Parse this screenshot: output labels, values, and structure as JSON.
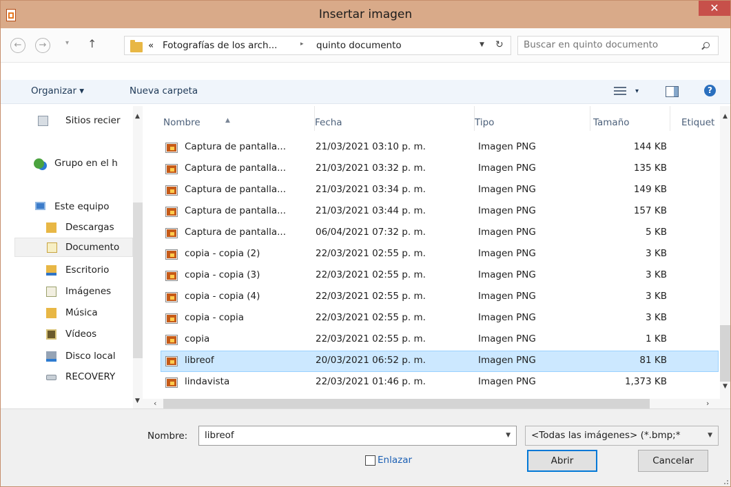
{
  "window": {
    "title": "Insertar imagen",
    "close_glyph": "✕"
  },
  "address": {
    "prefix": "«",
    "path": [
      "Fotografías de los arch...",
      "quinto documento"
    ],
    "separator": "▸"
  },
  "search": {
    "placeholder": "Buscar en quinto documento"
  },
  "toolbar": {
    "organize": "Organizar ▾",
    "new_folder": "Nueva carpeta",
    "view_dropdown": "▾"
  },
  "nav": {
    "items": [
      {
        "label": "Sitios recier",
        "icon": "recent-places-icon"
      },
      {
        "label": "Grupo en el h",
        "icon": "homegroup-icon"
      },
      {
        "label": "Este equipo",
        "icon": "computer-icon"
      },
      {
        "label": "Descargas",
        "icon": "downloads-folder-icon"
      },
      {
        "label": "Documento",
        "icon": "documents-folder-icon",
        "selected": true
      },
      {
        "label": "Escritorio",
        "icon": "desktop-folder-icon"
      },
      {
        "label": "Imágenes",
        "icon": "pictures-folder-icon"
      },
      {
        "label": "Música",
        "icon": "music-folder-icon"
      },
      {
        "label": "Vídeos",
        "icon": "videos-folder-icon"
      },
      {
        "label": "Disco local",
        "icon": "local-disk-icon"
      },
      {
        "label": "RECOVERY",
        "icon": "drive-icon"
      }
    ]
  },
  "columns": {
    "name": "Nombre",
    "date": "Fecha",
    "type": "Tipo",
    "size": "Tamaño",
    "tags": "Etiquet"
  },
  "files": [
    {
      "name": "Captura de pantalla...",
      "date": "21/03/2021 03:10 p. m.",
      "type": "Imagen PNG",
      "size": "144 KB"
    },
    {
      "name": "Captura de pantalla...",
      "date": "21/03/2021 03:32 p. m.",
      "type": "Imagen PNG",
      "size": "135 KB"
    },
    {
      "name": "Captura de pantalla...",
      "date": "21/03/2021 03:34 p. m.",
      "type": "Imagen PNG",
      "size": "149 KB"
    },
    {
      "name": "Captura de pantalla...",
      "date": "21/03/2021 03:44 p. m.",
      "type": "Imagen PNG",
      "size": "157 KB"
    },
    {
      "name": "Captura de pantalla...",
      "date": "06/04/2021 07:32 p. m.",
      "type": "Imagen PNG",
      "size": "5 KB"
    },
    {
      "name": "copia - copia (2)",
      "date": "22/03/2021 02:55 p. m.",
      "type": "Imagen PNG",
      "size": "3 KB"
    },
    {
      "name": "copia - copia (3)",
      "date": "22/03/2021 02:55 p. m.",
      "type": "Imagen PNG",
      "size": "3 KB"
    },
    {
      "name": "copia - copia (4)",
      "date": "22/03/2021 02:55 p. m.",
      "type": "Imagen PNG",
      "size": "3 KB"
    },
    {
      "name": "copia - copia",
      "date": "22/03/2021 02:55 p. m.",
      "type": "Imagen PNG",
      "size": "3 KB"
    },
    {
      "name": "copia",
      "date": "22/03/2021 02:55 p. m.",
      "type": "Imagen PNG",
      "size": "1 KB"
    },
    {
      "name": "libreof",
      "date": "20/03/2021 06:52 p. m.",
      "type": "Imagen PNG",
      "size": "81 KB",
      "selected": true
    },
    {
      "name": "lindavista",
      "date": "22/03/2021 01:46 p. m.",
      "type": "Imagen PNG",
      "size": "1,373 KB"
    }
  ],
  "footer": {
    "filename_label": "Nombre:",
    "filename_value": "libreof",
    "filetype": "<Todas las imágenes> (*.bmp;*",
    "link_label": "Enlazar",
    "open": "Abrir",
    "cancel": "Cancelar"
  },
  "colors": {
    "titlebar": "#d9aa89",
    "close": "#c7504a",
    "selection": "#cce8ff",
    "link": "#1a5fb4",
    "accent": "#0078d7"
  }
}
